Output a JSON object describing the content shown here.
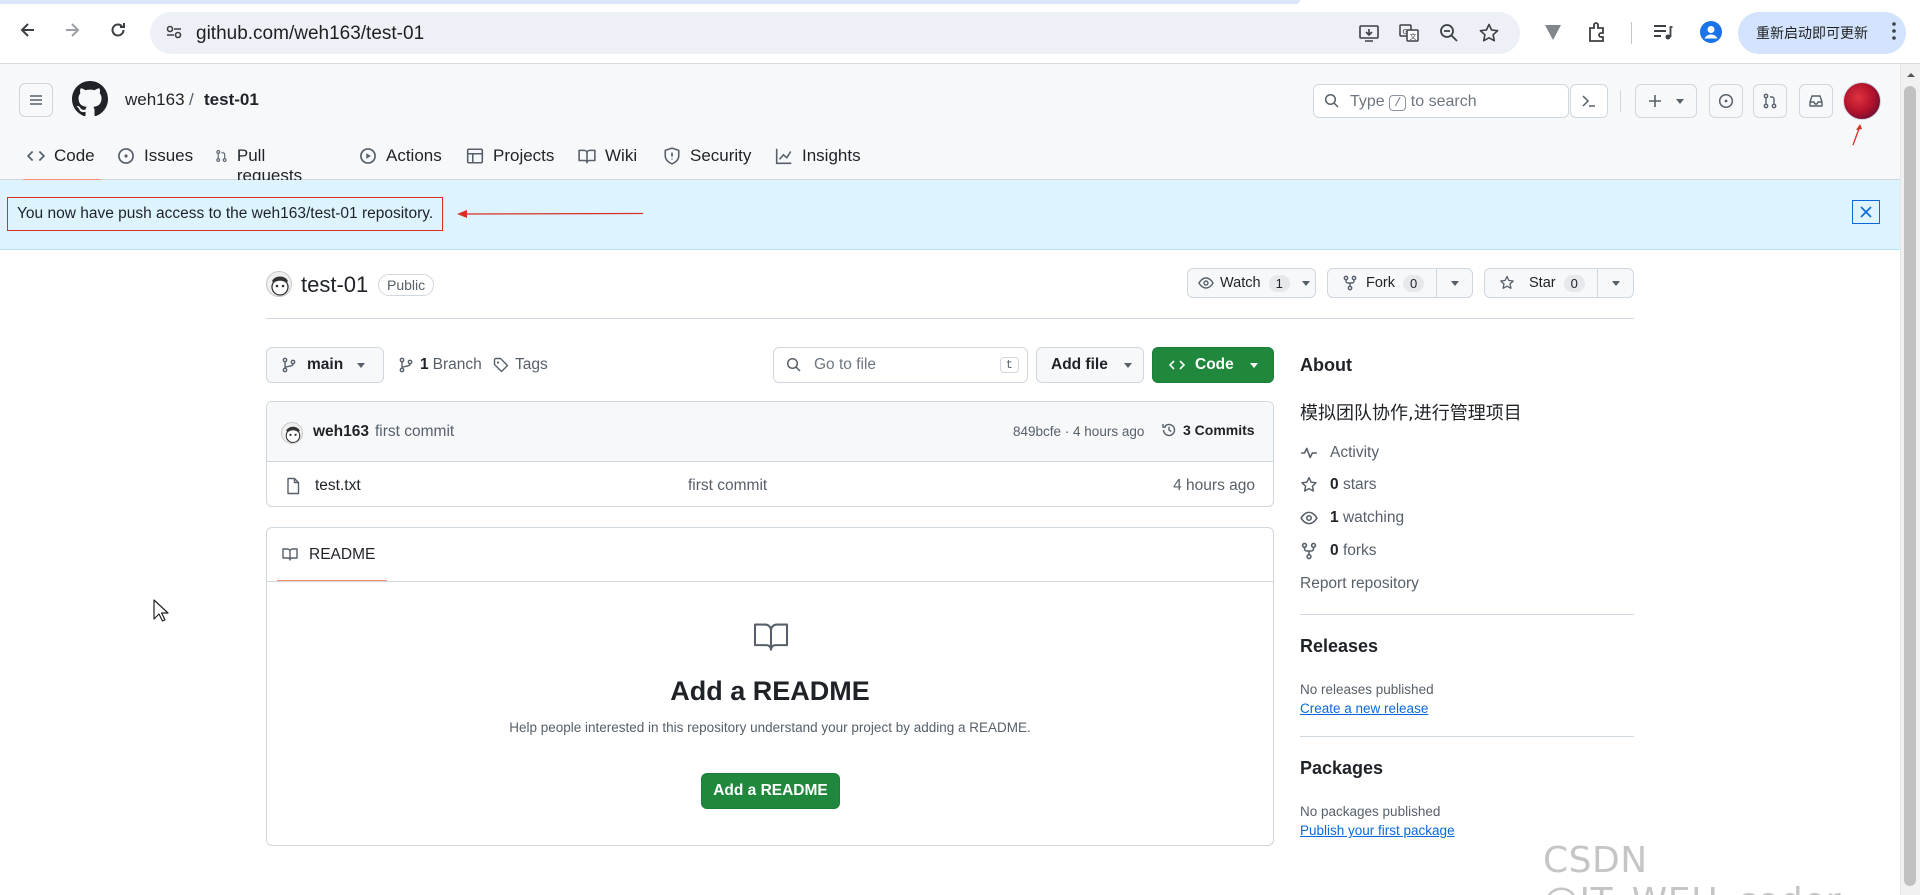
{
  "browser": {
    "url": "github.com/weh163/test-01",
    "update_button": "重新启动即可更新"
  },
  "header": {
    "owner": "weh163",
    "separator": "/",
    "repo": "test-01",
    "search_prefix": "Type",
    "search_key": "/",
    "search_suffix": "to search",
    "plus": "+"
  },
  "tabs": [
    {
      "label": "Code"
    },
    {
      "label": "Issues"
    },
    {
      "label": "Pull requests"
    },
    {
      "label": "Actions"
    },
    {
      "label": "Projects"
    },
    {
      "label": "Wiki"
    },
    {
      "label": "Security"
    },
    {
      "label": "Insights"
    }
  ],
  "flash": {
    "message": "You now have push access to the weh163/test-01 repository.",
    "annotation_color": "#d93025"
  },
  "repo": {
    "name": "test-01",
    "visibility": "Public",
    "watch_label": "Watch",
    "watch_count": "1",
    "fork_label": "Fork",
    "fork_count": "0",
    "star_label": "Star",
    "star_count": "0"
  },
  "toolbar": {
    "branch": "main",
    "branch_count": "1",
    "branch_label": "Branch",
    "tags_label": "Tags",
    "go_to_file": "Go to file",
    "go_to_file_key": "t",
    "add_file": "Add file",
    "code": "Code"
  },
  "commit": {
    "author": "weh163",
    "message": "first commit",
    "hash_time": "849bcfe · 4 hours ago",
    "commits_label": "3 Commits"
  },
  "files": [
    {
      "name": "test.txt",
      "message": "first commit",
      "time": "4 hours ago"
    }
  ],
  "readme": {
    "tab_label": "README",
    "heading": "Add a README",
    "help": "Help people interested in this repository understand your project by adding a README.",
    "button": "Add a README"
  },
  "about": {
    "heading": "About",
    "description": "模拟团队协作,进行管理项目",
    "activity": "Activity",
    "stars_count": "0",
    "stars_label": "stars",
    "watching_count": "1",
    "watching_label": "watching",
    "forks_count": "0",
    "forks_label": "forks",
    "report": "Report repository"
  },
  "releases": {
    "heading": "Releases",
    "empty": "No releases published",
    "link": "Create a new release"
  },
  "packages": {
    "heading": "Packages",
    "empty": "No packages published",
    "link": "Publish your first package"
  },
  "watermark": "CSDN @IT_WEH_coder",
  "colors": {
    "accent_green": "#1f883d",
    "link_blue": "#0969da",
    "flash_bg": "#ddf4ff",
    "tab_underline": "#fd8c73"
  }
}
